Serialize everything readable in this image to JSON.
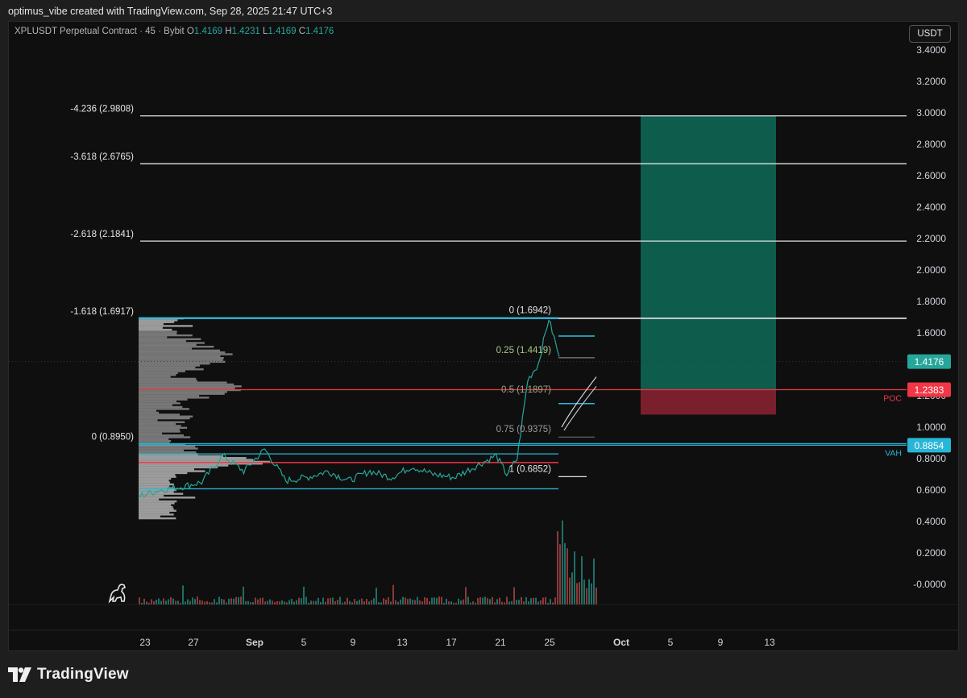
{
  "header": {
    "caption": "optimus_vibe created with TradingView.com, Sep 28, 2025 21:47 UTC+3"
  },
  "legend": {
    "symbol": "XPLUSDT Perpetual Contract · 45 · Bybit",
    "o_label": "O",
    "o_value": "1.4169",
    "h_label": "H",
    "h_value": "1.4231",
    "l_label": "L",
    "l_value": "1.4169",
    "c_label": "C",
    "c_value": "1.4176"
  },
  "currency_button": "USDT",
  "brand": "TradingView",
  "colors": {
    "background": "#0f0f0f",
    "up": "#26a69a",
    "down": "#ef5350",
    "poc": "#f23645",
    "vah": "#29b6d6",
    "target": "#0d5c4c",
    "stop": "#7a1f2c"
  },
  "chart_data": {
    "type": "line",
    "ylim": [
      -0.05,
      3.4
    ],
    "y_ticks": [
      "3.4000",
      "3.2000",
      "3.0000",
      "2.8000",
      "2.6000",
      "2.4000",
      "2.2000",
      "2.0000",
      "1.8000",
      "1.6000",
      "1.4000",
      "1.2000",
      "1.0000",
      "0.8000",
      "0.6000",
      "0.4000",
      "0.2000",
      "-0.0000"
    ],
    "x_ticks": [
      "23",
      "27",
      "Sep",
      "5",
      "9",
      "13",
      "17",
      "21",
      "25",
      "Oct",
      "5",
      "9",
      "13"
    ],
    "fib_extension_labels": [
      {
        "label": "-4.236 (2.9808)",
        "value": 2.9808
      },
      {
        "label": "-3.618 (2.6765)",
        "value": 2.6765
      },
      {
        "label": "-2.618 (2.1841)",
        "value": 2.1841
      },
      {
        "label": "-1.618 (1.6917)",
        "value": 1.6917
      },
      {
        "label": "0 (0.8950)",
        "value": 0.895
      }
    ],
    "fib_retracement_labels": [
      {
        "label": "0 (1.6942)",
        "value": 1.6942
      },
      {
        "label": "0.25 (1.4419)",
        "value": 1.4419
      },
      {
        "label": "0.5 (1.1897)",
        "value": 1.1897
      },
      {
        "label": "0.75 (0.9375)",
        "value": 0.9375
      },
      {
        "label": "1 (0.6852)",
        "value": 0.6852
      }
    ],
    "price_badges": [
      {
        "value": 1.4176,
        "text": "1.4176",
        "color": "#26a69a"
      },
      {
        "value": 1.2383,
        "text": "1.2383",
        "color": "#f23645"
      },
      {
        "value": 0.8854,
        "text": "0.8854",
        "color": "#29b6d6"
      }
    ],
    "level_tags": [
      {
        "text": "POC",
        "value": 1.2383,
        "color": "#f23645"
      },
      {
        "text": "VAH",
        "value": 0.8854,
        "color": "#29b6d6"
      }
    ],
    "position": {
      "entry": 1.2383,
      "target": 2.9808,
      "stop": 1.08
    },
    "series": [
      {
        "x": [
          0,
          2,
          4,
          6,
          8,
          10,
          12,
          14,
          16,
          18,
          20,
          22,
          24,
          26,
          28,
          30,
          32,
          34,
          35,
          36,
          36.5,
          37,
          38,
          39,
          40
        ],
        "values": [
          0.56,
          0.6,
          0.62,
          0.65,
          0.82,
          0.72,
          0.86,
          0.66,
          0.68,
          0.72,
          0.66,
          0.72,
          0.68,
          0.75,
          0.7,
          0.68,
          0.75,
          0.82,
          0.7,
          0.8,
          1.05,
          1.3,
          1.4,
          1.69,
          1.45
        ]
      }
    ]
  }
}
